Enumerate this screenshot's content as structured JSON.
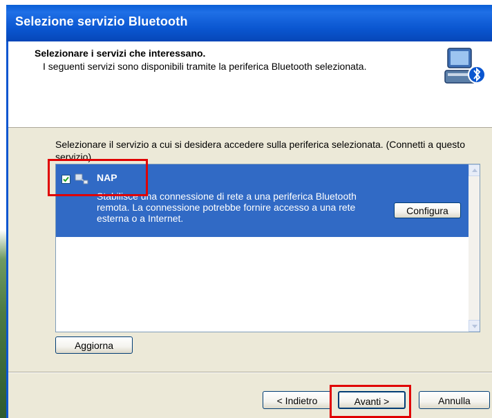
{
  "window": {
    "title": "Selezione servizio Bluetooth"
  },
  "header": {
    "title": "Selezionare i servizi che interessano.",
    "subtitle": "I seguenti servizi sono disponibili tramite la periferica Bluetooth selezionata.",
    "icon": "bluetooth-computer-icon"
  },
  "content": {
    "instruction": "Selezionare il servizio a cui si desidera accedere sulla periferica selezionata. (Connetti a questo servizio)",
    "services": [
      {
        "name": "NAP",
        "checked": true,
        "icon": "network-access-point-icon",
        "description": "Stabilisce una connessione di rete a una periferica Bluetooth remota. La connessione potrebbe fornire accesso a una rete esterna o a Internet.",
        "configure_label": "Configura"
      }
    ],
    "refresh_label": "Aggiorna"
  },
  "footer": {
    "back_label": "< Indietro",
    "next_label": "Avanti >",
    "cancel_label": "Annulla"
  },
  "colors": {
    "titlebar": "#0a56d0",
    "selection": "#316ac5",
    "highlight": "#e00000",
    "dialog_bg": "#ece9d8"
  }
}
